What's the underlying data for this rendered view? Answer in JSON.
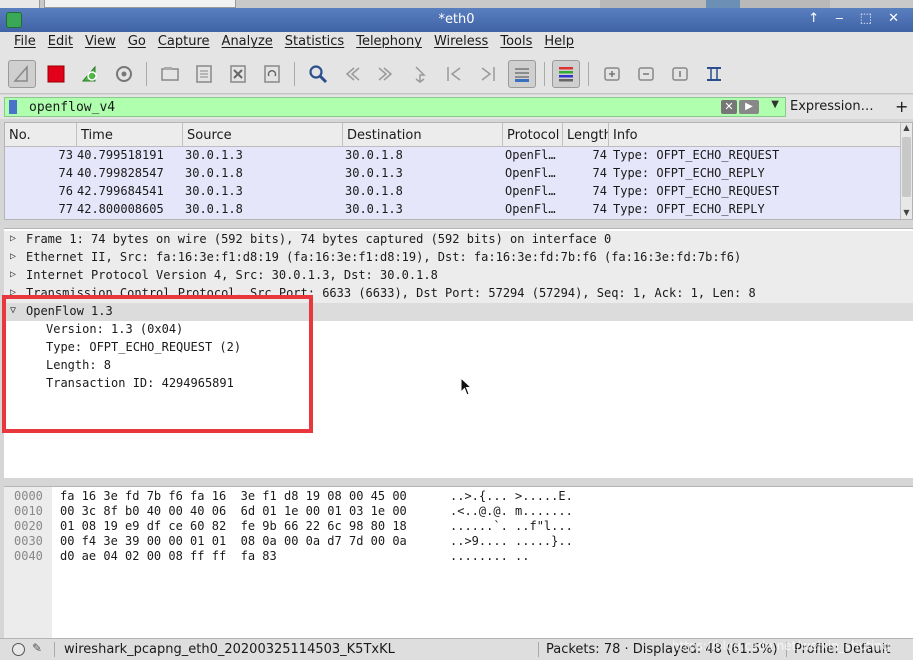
{
  "window": {
    "title": "*eth0",
    "controls": "↑ ‒ ⬚ ✕"
  },
  "menu": [
    "File",
    "Edit",
    "View",
    "Go",
    "Capture",
    "Analyze",
    "Statistics",
    "Telephony",
    "Wireless",
    "Tools",
    "Help"
  ],
  "toolbar": {
    "icons": [
      "shark-fin-start-icon",
      "stop-capture-icon",
      "restart-capture-icon",
      "capture-options-icon",
      "open-file-icon",
      "save-file-icon",
      "close-file-icon",
      "reload-file-icon",
      "find-packet-icon",
      "go-back-icon",
      "go-forward-icon",
      "go-to-packet-icon",
      "go-first-icon",
      "go-last-icon",
      "autoscroll-icon",
      "colorize-icon",
      "zoom-in-icon",
      "zoom-out-icon",
      "normal-size-icon",
      "resize-columns-icon"
    ]
  },
  "filter": {
    "value": "openflow_v4",
    "expression_label": "Expression…",
    "add_label": "+"
  },
  "packet_list": {
    "columns": [
      "No.",
      "Time",
      "Source",
      "Destination",
      "Protocol",
      "Length",
      "Info"
    ],
    "rows": [
      {
        "no": "73",
        "time": "40.799518191",
        "src": "30.0.1.3",
        "dst": "30.0.1.8",
        "proto": "OpenFl…",
        "len": "74",
        "info": "Type: OFPT_ECHO_REQUEST"
      },
      {
        "no": "74",
        "time": "40.799828547",
        "src": "30.0.1.8",
        "dst": "30.0.1.3",
        "proto": "OpenFl…",
        "len": "74",
        "info": "Type: OFPT_ECHO_REPLY"
      },
      {
        "no": "76",
        "time": "42.799684541",
        "src": "30.0.1.3",
        "dst": "30.0.1.8",
        "proto": "OpenFl…",
        "len": "74",
        "info": "Type: OFPT_ECHO_REQUEST"
      },
      {
        "no": "77",
        "time": "42.800008605",
        "src": "30.0.1.8",
        "dst": "30.0.1.3",
        "proto": "OpenFl…",
        "len": "74",
        "info": "Type: OFPT_ECHO_REPLY"
      }
    ]
  },
  "details": {
    "frame": "Frame 1: 74 bytes on wire (592 bits), 74 bytes captured (592 bits) on interface 0",
    "ethernet": "Ethernet II, Src: fa:16:3e:f1:d8:19 (fa:16:3e:f1:d8:19), Dst: fa:16:3e:fd:7b:f6 (fa:16:3e:fd:7b:f6)",
    "ip": "Internet Protocol Version 4, Src: 30.0.1.3, Dst: 30.0.1.8",
    "tcp": "Transmission Control Protocol, Src Port: 6633 (6633), Dst Port: 57294 (57294), Seq: 1, Ack: 1, Len: 8",
    "openflow": "OpenFlow 1.3",
    "version": "Version: 1.3 (0x04)",
    "type": "Type: OFPT_ECHO_REQUEST (2)",
    "length": "Length: 8",
    "xid": "Transaction ID: 4294965891"
  },
  "bytes": [
    {
      "off": "0000",
      "hex": "fa 16 3e fd 7b f6 fa 16  3e f1 d8 19 08 00 45 00",
      "ascii": "..>.{... >.....E."
    },
    {
      "off": "0010",
      "hex": "00 3c 8f b0 40 00 40 06  6d 01 1e 00 01 03 1e 00",
      "ascii": ".<..@.@. m......."
    },
    {
      "off": "0020",
      "hex": "01 08 19 e9 df ce 60 82  fe 9b 66 22 6c 98 80 18",
      "ascii": "......`. ..f\"l..."
    },
    {
      "off": "0030",
      "hex": "00 f4 3e 39 00 00 01 01  08 0a 00 0a d7 7d 00 0a",
      "ascii": "..>9.... .....}.."
    },
    {
      "off": "0040",
      "hex": "d0 ae 04 02 00 08 ff ff  fa 83",
      "ascii": "........ .."
    }
  ],
  "status": {
    "file": "wireshark_pcapng_eth0_20200325114503_K5TxKL",
    "packets": "Packets: 78 · Displayed: 48 (61.5%)",
    "profile": "Profile: Default",
    "watermark": "https://blog.csdn.net/weixin_shuting"
  },
  "colors": {
    "row_bg": "#e6e6fa",
    "filter_ok": "#afffaf",
    "highlight_box": "#e8383d"
  }
}
